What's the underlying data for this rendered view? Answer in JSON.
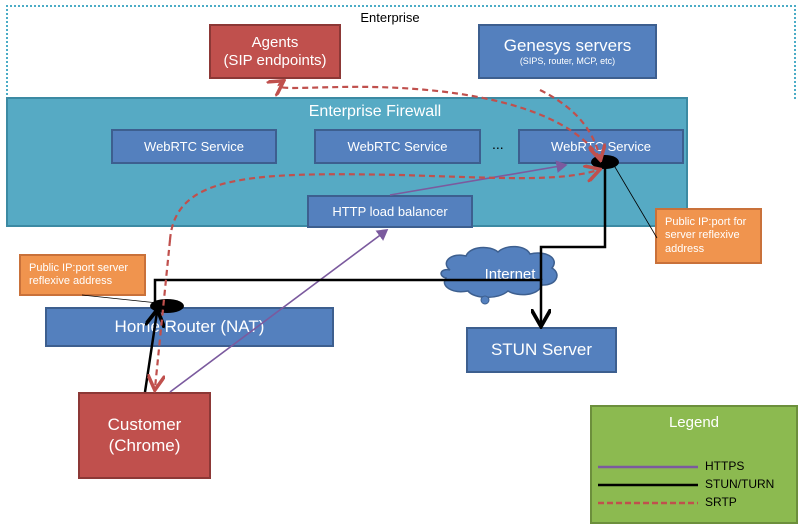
{
  "zones": {
    "enterprise_label": "Enterprise",
    "firewall_label": "Enterprise Firewall"
  },
  "nodes": {
    "agents": {
      "line1": "Agents",
      "line2": "(SIP endpoints)"
    },
    "genesys": {
      "line1": "Genesys servers",
      "line2": "(SIPS, router, MCP, etc)"
    },
    "webrtc_1": "WebRTC Service",
    "webrtc_2": "WebRTC Service",
    "ellipsis": "...",
    "webrtc_3": "WebRTC Service",
    "load_balancer": "HTTP load balancer",
    "internet": "Internet",
    "home_router": "Home Router (NAT)",
    "stun_server": "STUN Server",
    "customer": {
      "line1": "Customer",
      "line2": "(Chrome)"
    }
  },
  "callouts": {
    "server_reflexive": "Public IP:port for server reflexive address",
    "client_reflexive": "Public IP:port server reflexive address"
  },
  "legend": {
    "title": "Legend",
    "items": [
      {
        "label": "HTTPS",
        "style": "solid",
        "color": "#7b5a9e"
      },
      {
        "label": "STUN/TURN",
        "style": "solid",
        "color": "#000000"
      },
      {
        "label": "SRTP",
        "style": "dashed",
        "color": "#c0504d"
      }
    ]
  },
  "colors": {
    "firewall": "#56aac4",
    "blue_box": "#5480be",
    "red_box": "#c0504d",
    "orange_callout": "#f0944e",
    "legend_box": "#8cba50"
  }
}
